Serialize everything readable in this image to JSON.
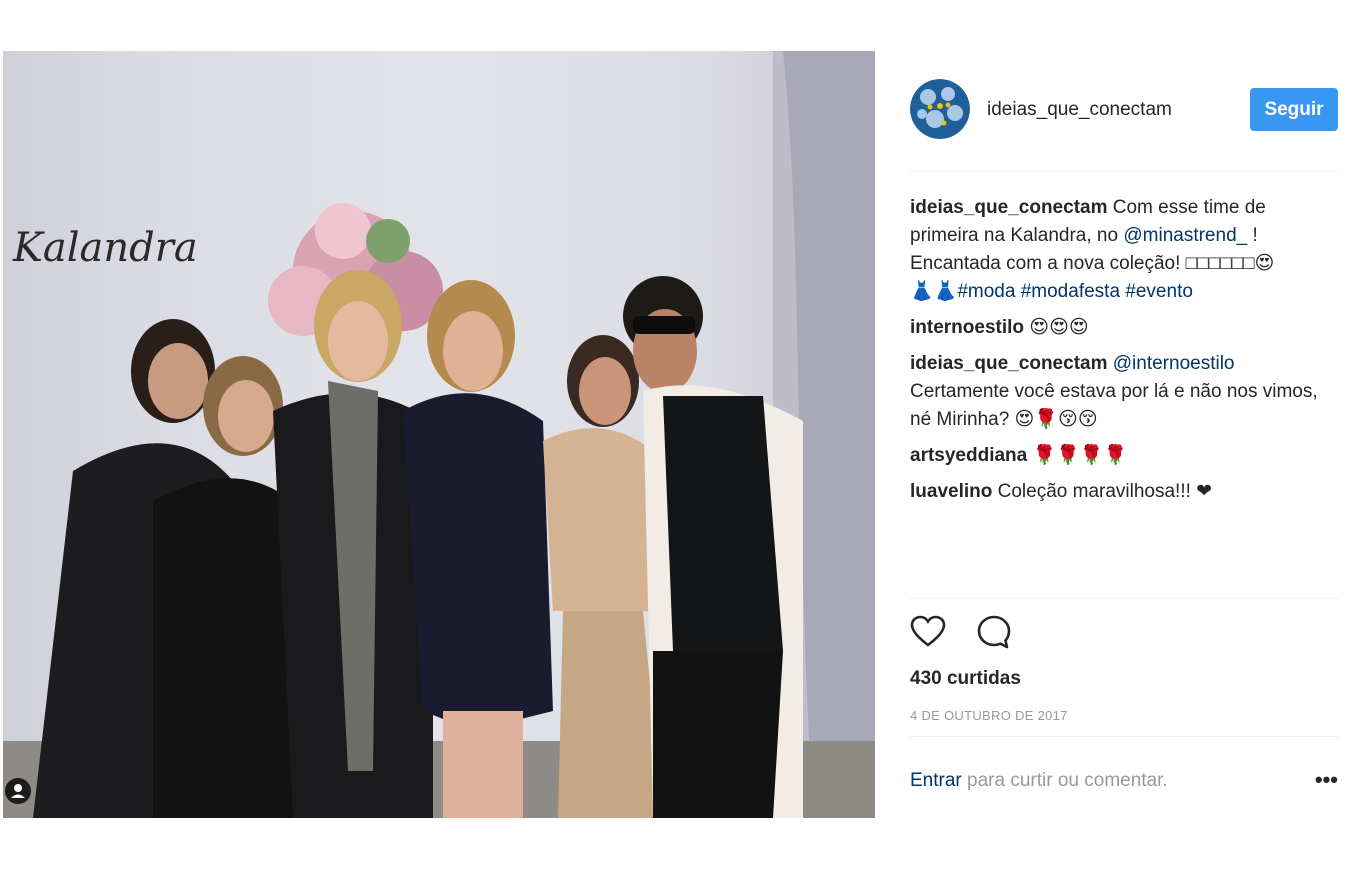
{
  "post": {
    "username": "ideias_que_conectam",
    "follow_label": "Seguir",
    "photo_signage": "Kalandra",
    "caption": {
      "user": "ideias_que_conectam",
      "text_1": "Com esse time de primeira na Kalandra, no",
      "mention": "@minastrend_",
      "text_2": "! Encantada com a nova coleção! □□□□□□",
      "emoji_1": "😍",
      "dress_emoji": "👗👗",
      "tags": [
        "#moda",
        "#modafesta",
        "#evento"
      ]
    },
    "comments": [
      {
        "user": "internoestilo",
        "text": "😍😍😍"
      },
      {
        "user": "ideias_que_conectam",
        "mention": "@internoestilo",
        "text": "Certamente você estava por lá e não nos vimos, né Mirinha? 😍🌹😚😚"
      },
      {
        "user": "artsyeddiana",
        "text": "🌹🌹🌹🌹"
      },
      {
        "user": "luavelino",
        "text": "Coleção maravilhosa!!! ❤"
      }
    ],
    "likes": "430 curtidas",
    "date": "4 DE OUTUBRO DE 2017",
    "login_link": "Entrar",
    "login_text": "para curtir ou comentar.",
    "more_label": "•••"
  },
  "icons": {
    "like": "heart-outline-icon",
    "comment": "speech-bubble-icon",
    "tag": "person-tag-icon"
  },
  "colors": {
    "follow_button": "#3897f0",
    "link": "#003569",
    "muted": "#999999",
    "divider": "#efefef"
  }
}
